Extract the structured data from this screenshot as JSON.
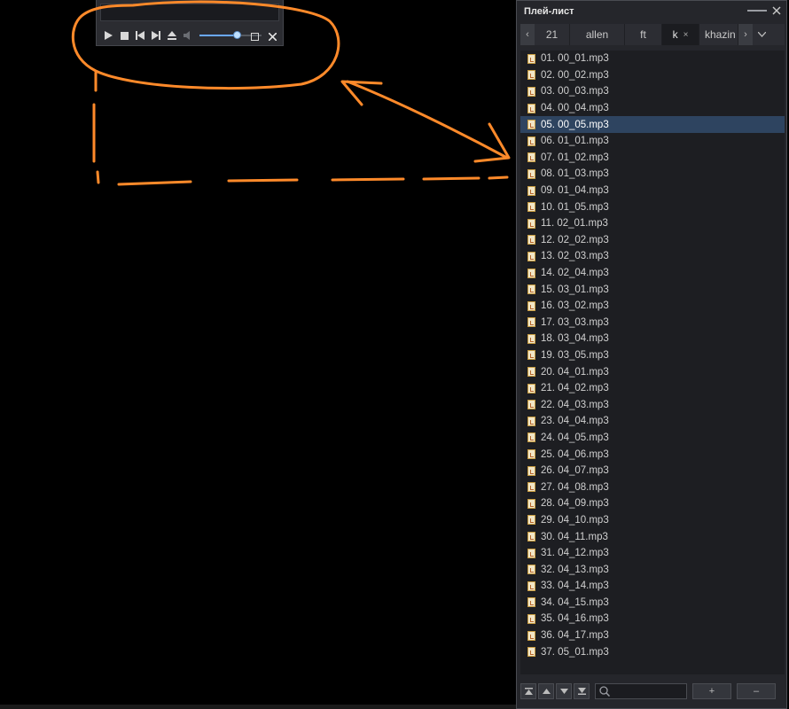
{
  "player": {
    "buttons": [
      "play-icon",
      "stop-icon",
      "prev-icon",
      "next-icon",
      "eject-icon",
      "volume-icon"
    ],
    "volume": 0.6
  },
  "playlist": {
    "title": "Плей-лист",
    "tabs": [
      {
        "label": "21",
        "active": false
      },
      {
        "label": "allen",
        "active": false
      },
      {
        "label": "ft",
        "active": false
      },
      {
        "label": "k",
        "active": true,
        "close": "×"
      },
      {
        "label": "khazin",
        "active": false
      }
    ],
    "nav_left": "‹",
    "nav_right": "›",
    "selected_index": 4,
    "items": [
      "01. 00_01.mp3",
      "02. 00_02.mp3",
      "03. 00_03.mp3",
      "04. 00_04.mp3",
      "05. 00_05.mp3",
      "06. 01_01.mp3",
      "07. 01_02.mp3",
      "08. 01_03.mp3",
      "09. 01_04.mp3",
      "10. 01_05.mp3",
      "11. 02_01.mp3",
      "12. 02_02.mp3",
      "13. 02_03.mp3",
      "14. 02_04.mp3",
      "15. 03_01.mp3",
      "16. 03_02.mp3",
      "17. 03_03.mp3",
      "18. 03_04.mp3",
      "19. 03_05.mp3",
      "20. 04_01.mp3",
      "21. 04_02.mp3",
      "22. 04_03.mp3",
      "23. 04_04.mp3",
      "24. 04_05.mp3",
      "25. 04_06.mp3",
      "26. 04_07.mp3",
      "27. 04_08.mp3",
      "28. 04_09.mp3",
      "29. 04_10.mp3",
      "30. 04_11.mp3",
      "31. 04_12.mp3",
      "32. 04_13.mp3",
      "33. 04_14.mp3",
      "34. 04_15.mp3",
      "35. 04_16.mp3",
      "36. 04_17.mp3",
      "37. 05_01.mp3"
    ],
    "bottom": {
      "plus": "+",
      "minus": "–"
    }
  },
  "colors": {
    "annotation": "#ff8a2a",
    "selection": "#2e4460",
    "background": "#000000"
  }
}
